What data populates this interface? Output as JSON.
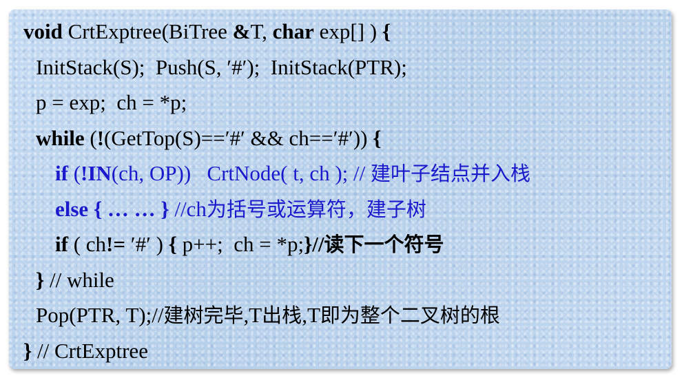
{
  "code": {
    "line1": {
      "kw_void": "void",
      "t1": " CrtExptree(BiTree ",
      "amp": "&",
      "t2": "T, ",
      "kw_char": "char",
      "t3": " exp[] ) ",
      "brace": "{"
    },
    "line2": {
      "text": "InitStack(S);  Push(S, ′#′);  InitStack(PTR);"
    },
    "line3": {
      "text": "p = exp;  ch = *p;"
    },
    "line4": {
      "kw_while": "while",
      "t1": " (",
      "not": "!",
      "t2": "(GetTop(S)==′#′ && ch==′#′)) ",
      "brace": "{"
    },
    "line5": {
      "kw_if": "if",
      "t1": " (",
      "not_in": "!IN",
      "t2": "(ch, OP))   CrtNode( t, ch ); // ",
      "comment": "建叶子结点并入栈"
    },
    "line6": {
      "kw_else": "else",
      "t1": " { ",
      "dots": "… …",
      "t2": " } ",
      "comment_pre": "//ch",
      "comment": "为括号或运算符，建子树"
    },
    "line7": {
      "kw_if": "if",
      "t1": " ( ch",
      "neq": "!=",
      "t2": " ′#′ ) ",
      "brace_open": "{",
      "t3": " p++;  ch = *p;",
      "brace_close": "}",
      "comment_pre": "//",
      "comment": "读下一个符号"
    },
    "line8": {
      "brace": "}",
      "t1": " // while"
    },
    "line9": {
      "t1": "Pop(PTR, T);//",
      "c1": "建树完毕",
      "t2": ",T",
      "c2": "出栈",
      "t3": ",T",
      "c3": "即为整个二叉树的根"
    },
    "line10": {
      "brace": "}",
      "t1": " // CrtExptree"
    }
  },
  "colors": {
    "panel_background": "#bcd4ee",
    "keyword_blue": "#1a1acc",
    "text": "#000000"
  }
}
